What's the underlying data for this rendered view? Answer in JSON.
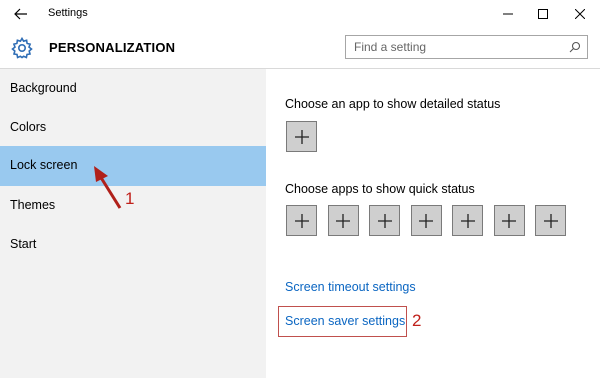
{
  "window": {
    "title": "Settings"
  },
  "header": {
    "section_title": "PERSONALIZATION",
    "search_placeholder": "Find a setting"
  },
  "sidebar": {
    "items": [
      {
        "label": "Background",
        "selected": false
      },
      {
        "label": "Colors",
        "selected": false
      },
      {
        "label": "Lock screen",
        "selected": true
      },
      {
        "label": "Themes",
        "selected": false
      },
      {
        "label": "Start",
        "selected": false
      }
    ]
  },
  "main": {
    "detailed_status_label": "Choose an app to show detailed status",
    "quick_status_label": "Choose apps to show quick status",
    "quick_status_slot_count": 7,
    "screen_timeout_link": "Screen timeout settings",
    "screen_saver_link": "Screen saver settings"
  },
  "annotations": {
    "arrow_number": "1",
    "box_number": "2",
    "color": "#c0201a"
  },
  "colors": {
    "selected_bg": "#99c9ef",
    "sidebar_bg": "#f2f2f2",
    "link": "#0b66c2"
  }
}
